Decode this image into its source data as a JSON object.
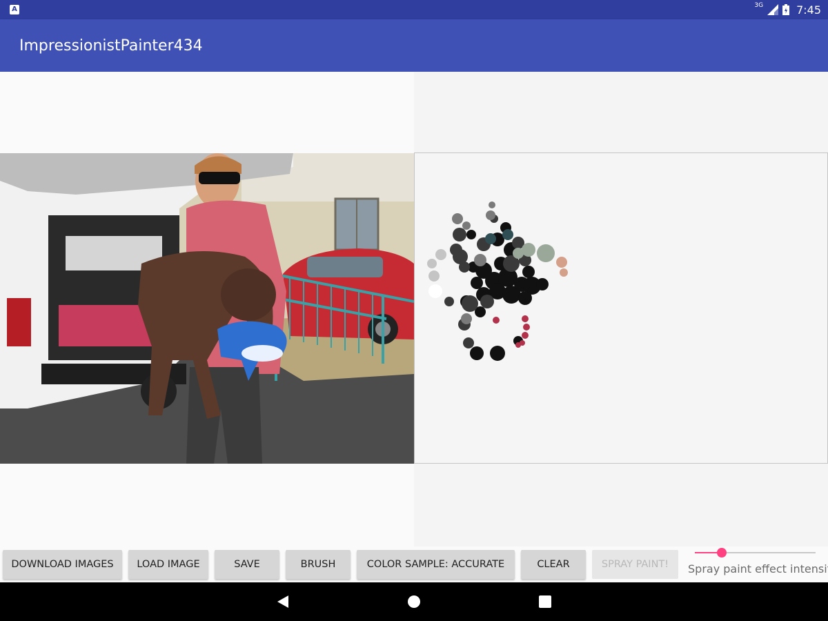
{
  "status_bar": {
    "network": "3G",
    "time": "7:45",
    "icons": [
      "app-notification-icon",
      "signal-icon",
      "battery-icon"
    ]
  },
  "app_bar": {
    "title": "ImpressionistPainter434"
  },
  "source_image": {
    "description_icon": "photo-image"
  },
  "toolbar": {
    "download_images": "DOWNLOAD IMAGES",
    "load_image": "LOAD IMAGE",
    "save": "SAVE",
    "brush": "BRUSH",
    "color_sample": "COLOR SAMPLE: ACCURATE",
    "clear": "CLEAR",
    "spray_paint": "SPRAY PAINT!"
  },
  "slider": {
    "label": "Spray paint effect intensity",
    "value_fraction": 0.22
  },
  "colors": {
    "primary": "#3f51b5",
    "primary_dark": "#303f9f",
    "accent": "#ff4081"
  },
  "nav_bar": {
    "icons": [
      "back-icon",
      "home-icon",
      "recents-icon"
    ]
  }
}
